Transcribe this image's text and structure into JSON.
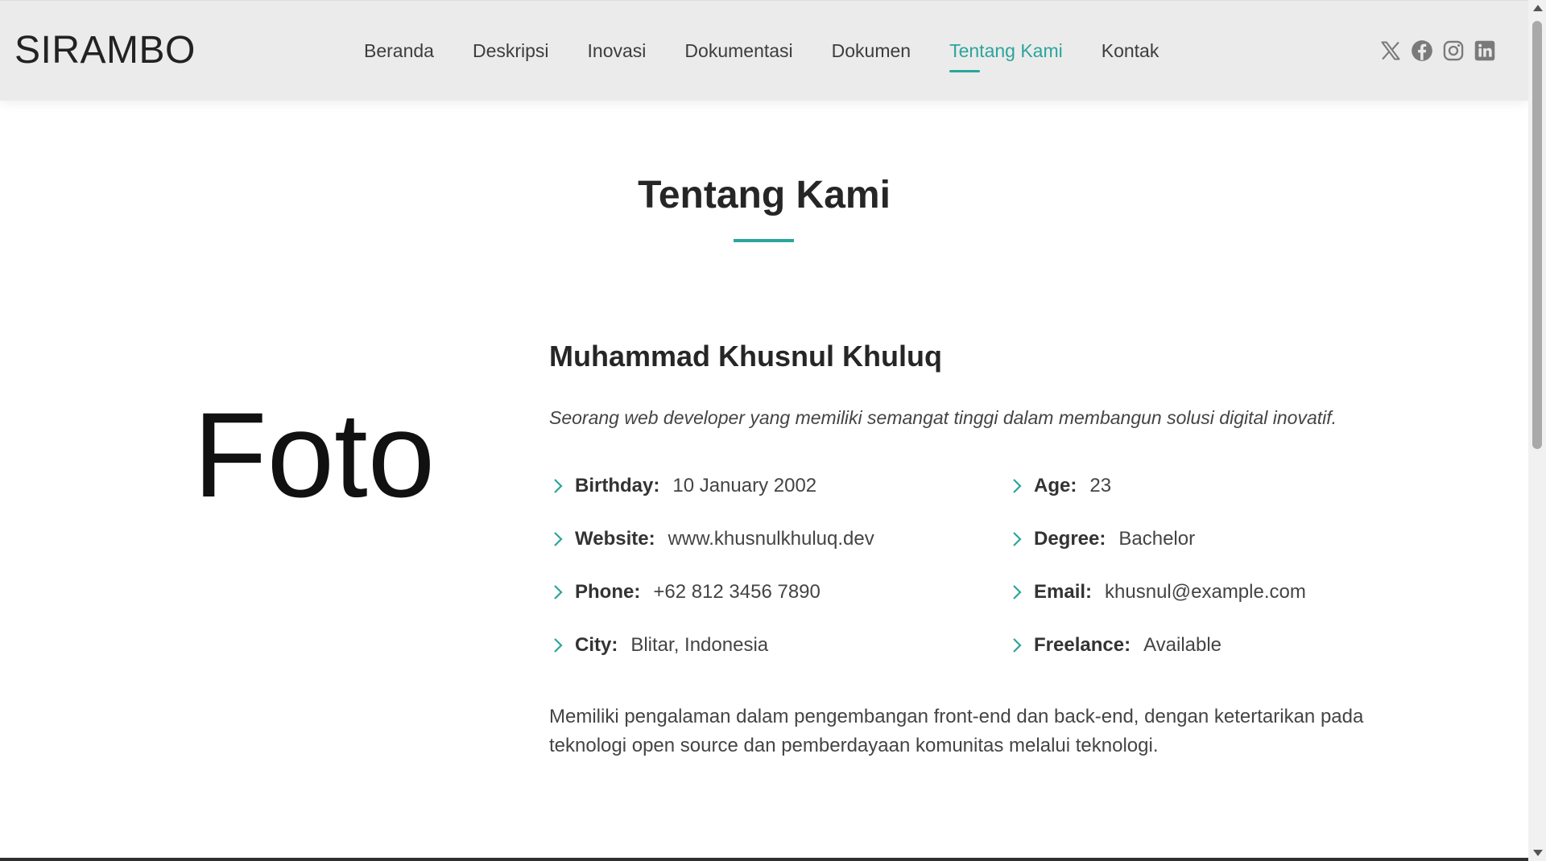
{
  "header": {
    "logo": "SIRAMBO",
    "nav": [
      {
        "label": "Beranda"
      },
      {
        "label": "Deskripsi"
      },
      {
        "label": "Inovasi"
      },
      {
        "label": "Dokumentasi"
      },
      {
        "label": "Dokumen"
      },
      {
        "label": "Tentang Kami",
        "active": true
      },
      {
        "label": "Kontak"
      }
    ],
    "socials": [
      "x-icon",
      "facebook-icon",
      "instagram-icon",
      "linkedin-icon"
    ]
  },
  "section": {
    "title": "Tentang Kami"
  },
  "profile": {
    "photo_placeholder": "Foto",
    "name": "Muhammad Khusnul Khuluq",
    "tagline": "Seorang web developer yang memiliki semangat tinggi dalam membangun solusi digital inovatif.",
    "details": [
      {
        "label": "Birthday:",
        "value": "10 January 2002"
      },
      {
        "label": "Age:",
        "value": "23"
      },
      {
        "label": "Website:",
        "value": "www.khusnulkhuluq.dev"
      },
      {
        "label": "Degree:",
        "value": "Bachelor"
      },
      {
        "label": "Phone:",
        "value": "+62 812 3456 7890"
      },
      {
        "label": "Email:",
        "value": "khusnul@example.com"
      },
      {
        "label": "City:",
        "value": "Blitar, Indonesia"
      },
      {
        "label": "Freelance:",
        "value": "Available"
      }
    ],
    "description": "Memiliki pengalaman dalam pengembangan front-end dan back-end, dengan ketertarikan pada teknologi open source dan pemberdayaan komunitas melalui teknologi."
  },
  "colors": {
    "accent": "#2ba59b",
    "header_bg": "#ebebeb",
    "text": "#444444",
    "heading": "#262626"
  }
}
